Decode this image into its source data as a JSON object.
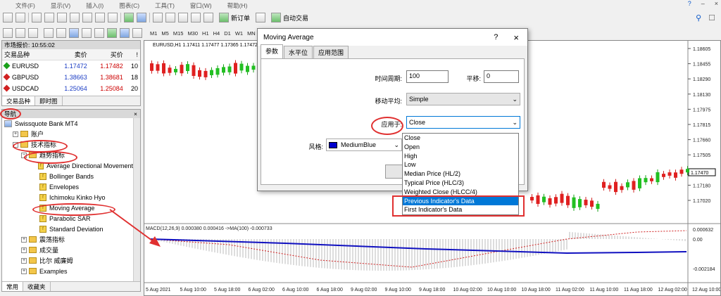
{
  "menu": [
    "文件(F)",
    "显示(V)",
    "插入(I)",
    "图表(C)",
    "工具(T)",
    "窗口(W)",
    "帮助(H)"
  ],
  "window_buttons": [
    "?",
    "–",
    "×"
  ],
  "toolbar": {
    "new_order": "新订单",
    "auto_trade": "自动交易",
    "timeframes": [
      "M1",
      "M5",
      "M15",
      "M30",
      "H1",
      "H4",
      "D1",
      "W1",
      "MN"
    ]
  },
  "market_watch": {
    "title": "市场报价: 10:55:02",
    "headers": [
      "交易品种",
      "卖价",
      "买价",
      "!"
    ],
    "rows": [
      {
        "symbol": "EURUSD",
        "bid": "1.17472",
        "ask": "1.17482",
        "spread": "10",
        "color": "#1aa01a"
      },
      {
        "symbol": "GBPUSD",
        "bid": "1.38663",
        "ask": "1.38681",
        "spread": "18",
        "color": "#d02020"
      },
      {
        "symbol": "USDCAD",
        "bid": "1.25064",
        "ask": "1.25084",
        "spread": "20",
        "color": "#d02020"
      }
    ],
    "tabs": [
      "交易品种",
      "即时图"
    ]
  },
  "navigator": {
    "title": "导航",
    "close": "×",
    "items": [
      {
        "label": "Swissquote Bank MT4",
        "indent": 0,
        "type": "root"
      },
      {
        "label": "账户",
        "indent": 1,
        "type": "folder",
        "pm": "+"
      },
      {
        "label": "技术指标",
        "indent": 1,
        "type": "folder",
        "pm": "−"
      },
      {
        "label": "趋势指标",
        "indent": 2,
        "type": "folder",
        "pm": "−"
      },
      {
        "label": "Average Directional Movement",
        "indent": 3,
        "type": "ind"
      },
      {
        "label": "Bollinger Bands",
        "indent": 3,
        "type": "ind"
      },
      {
        "label": "Envelopes",
        "indent": 3,
        "type": "ind"
      },
      {
        "label": "Ichimoku Kinko Hyo",
        "indent": 3,
        "type": "ind"
      },
      {
        "label": "Moving Average",
        "indent": 3,
        "type": "ind"
      },
      {
        "label": "Parabolic SAR",
        "indent": 3,
        "type": "ind"
      },
      {
        "label": "Standard Deviation",
        "indent": 3,
        "type": "ind"
      },
      {
        "label": "震荡指标",
        "indent": 2,
        "type": "folder",
        "pm": "+"
      },
      {
        "label": "成交量",
        "indent": 2,
        "type": "folder",
        "pm": "+"
      },
      {
        "label": "比尔 威廉姆",
        "indent": 2,
        "type": "folder",
        "pm": "+"
      },
      {
        "label": "Examples",
        "indent": 2,
        "type": "folder",
        "pm": "+"
      }
    ],
    "tabs": [
      "常用",
      "收藏夹"
    ]
  },
  "chart": {
    "header": "EURUSD,H1  1.17411 1.17477 1.17365 1.17472",
    "price_labels": [
      "1.18605",
      "1.18455",
      "1.18290",
      "1.18130",
      "1.17975",
      "1.17815",
      "1.17660",
      "1.17505",
      "1.17345",
      "1.17180",
      "1.17020"
    ],
    "current_price": "1.17470",
    "macd_header": "MACD(12,26,9) 0.000380 0.000416 ->MA(100) -0.000733",
    "macd_labels": [
      "0.000632",
      "0.00",
      "-0.002184"
    ],
    "time_labels": [
      "5 Aug 2021",
      "5 Aug 10:00",
      "5 Aug 18:00",
      "6 Aug 02:00",
      "6 Aug 10:00",
      "6 Aug 18:00",
      "9 Aug 02:00",
      "9 Aug 10:00",
      "9 Aug 18:00",
      "10 Aug 02:00",
      "10 Aug 10:00",
      "10 Aug 18:00",
      "11 Aug 02:00",
      "11 Aug 10:00",
      "11 Aug 18:00",
      "12 Aug 02:00",
      "12 Aug 10:00"
    ]
  },
  "dialog": {
    "title": "Moving Average",
    "help": "?",
    "close": "×",
    "tabs": [
      "参数",
      "水平位",
      "应用范围"
    ],
    "period_label": "时间周期:",
    "period_value": "100",
    "shift_label": "平移:",
    "shift_value": "0",
    "method_label": "移动平均:",
    "method_value": "Simple",
    "apply_label": "应用于:",
    "apply_value": "Close",
    "style_label": "风格:",
    "style_color_name": "MediumBlue",
    "style_color": "#0000cd",
    "ok_label": "确",
    "apply_options": [
      "Close",
      "Open",
      "High",
      "Low",
      "Median Price (HL/2)",
      "Typical Price (HLC/3)",
      "Weighted Close (HLCC/4)",
      "Previous Indicator's Data",
      "First Indicator's Data"
    ],
    "highlighted": "Previous Indicator's Data"
  }
}
